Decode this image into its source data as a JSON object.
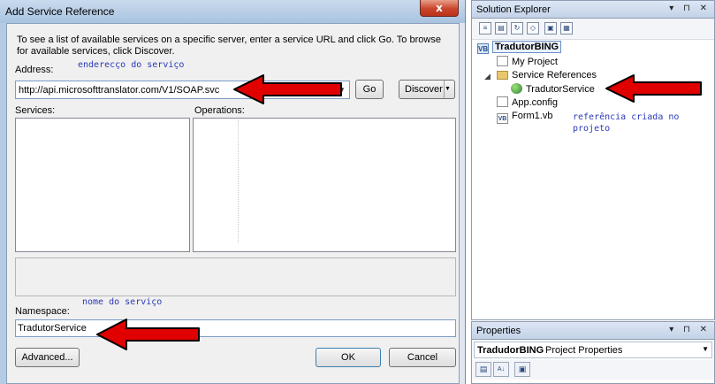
{
  "dialog": {
    "title": "Add Service Reference",
    "close_glyph": "x",
    "instructions": "To see a list of available services on a specific server, enter a service URL and click Go. To browse for available services, click Discover.",
    "address_label": "Address:",
    "address_value": "http://api.microsofttranslator.com/V1/SOAP.svc",
    "go_label": "Go",
    "discover_label": "Discover",
    "services_label": "Services:",
    "operations_label": "Operations:",
    "namespace_label": "Namespace:",
    "namespace_value": "TradutorService",
    "advanced_label": "Advanced...",
    "ok_label": "OK",
    "cancel_label": "Cancel"
  },
  "annotations": {
    "address_note": "enderecço do serviço",
    "namespace_note": "nome do serviço",
    "reference_note": "referência criada no projeto",
    "arrow_color": "#e00000"
  },
  "solution_explorer": {
    "title": "Solution Explorer",
    "title_buttons": "▾ ⊓ ✕",
    "tree": {
      "project": "TradutorBING",
      "my_project": "My Project",
      "service_references": "Service References",
      "service_item": "TradutorService",
      "app_config": "App.config",
      "form1": "Form1.vb"
    }
  },
  "properties": {
    "title": "Properties",
    "title_buttons": "▾ ⊓ ✕",
    "selector_name": "TradudorBING",
    "selector_type": "Project Properties"
  }
}
